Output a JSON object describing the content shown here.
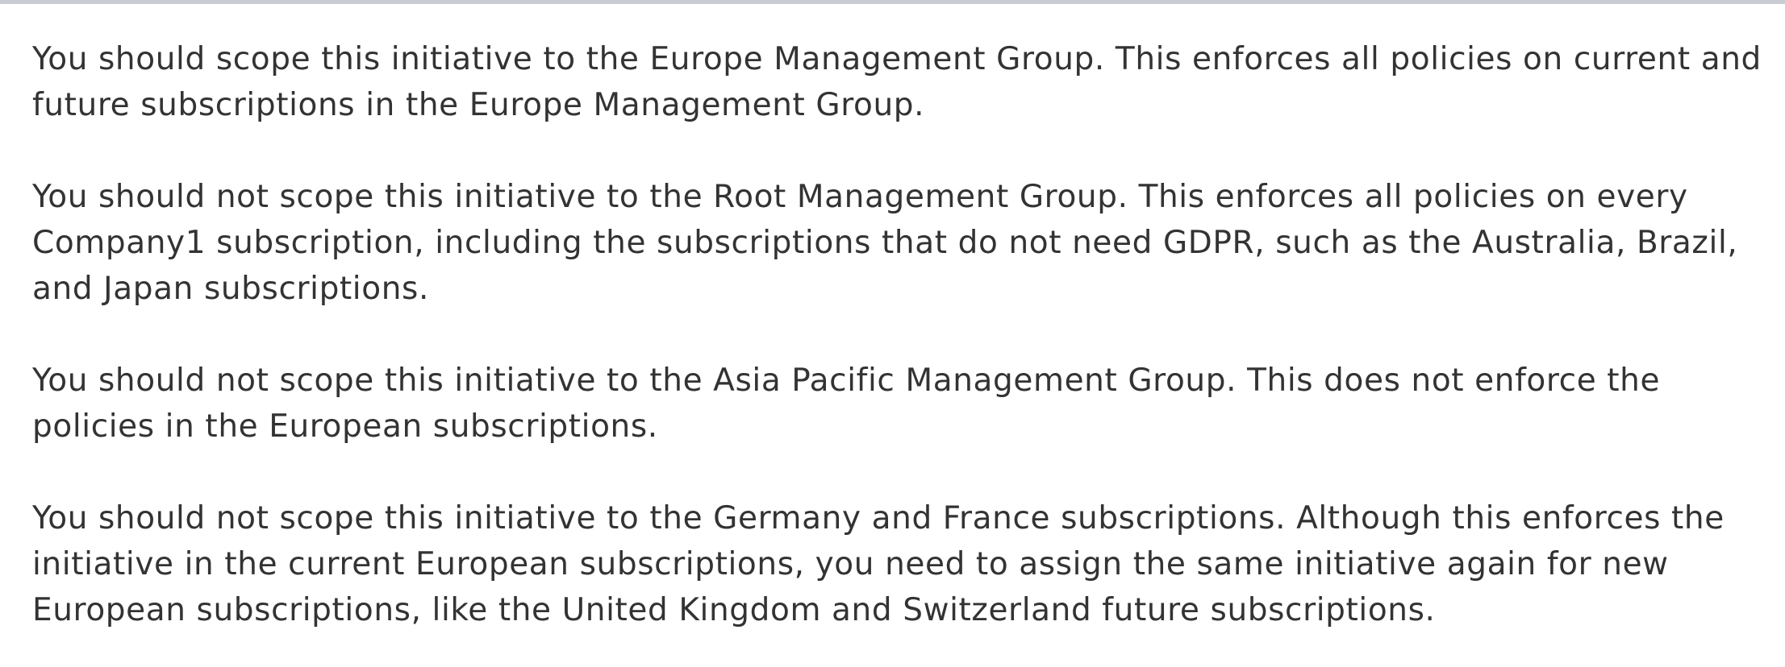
{
  "explanation": {
    "paragraphs": [
      "You should scope this initiative to the Europe Management Group. This enforces all policies on current and future subscriptions in the Europe Management Group.",
      "You should not scope this initiative to the Root Management Group. This enforces all policies on every Company1 subscription, including the subscriptions that do not need GDPR, such as the Australia, Brazil, and Japan subscriptions.",
      "You should not scope this initiative to the Asia Pacific Management Group. This does not enforce the policies in the European subscriptions.",
      "You should not scope this initiative to the Germany and France subscriptions. Although this enforces the initiative in the current European subscriptions, you need to assign the same initiative again for new European subscriptions, like the United Kingdom and Switzerland future subscriptions."
    ]
  }
}
